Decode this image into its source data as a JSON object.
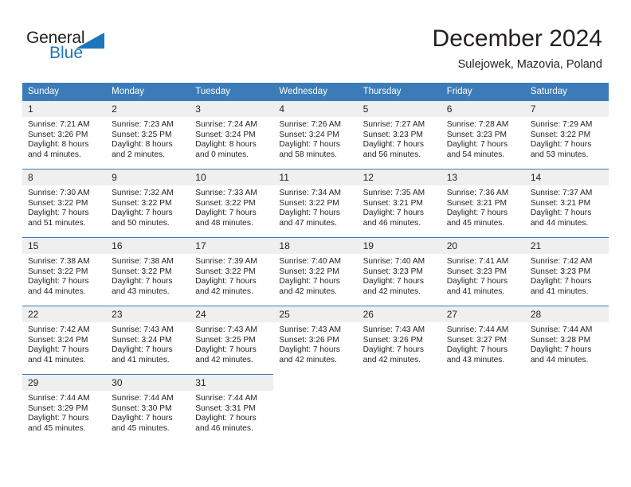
{
  "brand": {
    "name_part1": "General",
    "name_part2": "Blue",
    "triangle_color": "#1b76bc"
  },
  "header": {
    "title": "December 2024",
    "location": "Sulejowek, Mazovia, Poland"
  },
  "colors": {
    "header_row": "#3b7cb8",
    "daynum_background": "#efefef",
    "text": "#231f20"
  },
  "weekday_headers": [
    "Sunday",
    "Monday",
    "Tuesday",
    "Wednesday",
    "Thursday",
    "Friday",
    "Saturday"
  ],
  "weeks": [
    [
      {
        "day": "1",
        "sunrise": "Sunrise: 7:21 AM",
        "sunset": "Sunset: 3:26 PM",
        "daylight1": "Daylight: 8 hours",
        "daylight2": "and 4 minutes."
      },
      {
        "day": "2",
        "sunrise": "Sunrise: 7:23 AM",
        "sunset": "Sunset: 3:25 PM",
        "daylight1": "Daylight: 8 hours",
        "daylight2": "and 2 minutes."
      },
      {
        "day": "3",
        "sunrise": "Sunrise: 7:24 AM",
        "sunset": "Sunset: 3:24 PM",
        "daylight1": "Daylight: 8 hours",
        "daylight2": "and 0 minutes."
      },
      {
        "day": "4",
        "sunrise": "Sunrise: 7:26 AM",
        "sunset": "Sunset: 3:24 PM",
        "daylight1": "Daylight: 7 hours",
        "daylight2": "and 58 minutes."
      },
      {
        "day": "5",
        "sunrise": "Sunrise: 7:27 AM",
        "sunset": "Sunset: 3:23 PM",
        "daylight1": "Daylight: 7 hours",
        "daylight2": "and 56 minutes."
      },
      {
        "day": "6",
        "sunrise": "Sunrise: 7:28 AM",
        "sunset": "Sunset: 3:23 PM",
        "daylight1": "Daylight: 7 hours",
        "daylight2": "and 54 minutes."
      },
      {
        "day": "7",
        "sunrise": "Sunrise: 7:29 AM",
        "sunset": "Sunset: 3:22 PM",
        "daylight1": "Daylight: 7 hours",
        "daylight2": "and 53 minutes."
      }
    ],
    [
      {
        "day": "8",
        "sunrise": "Sunrise: 7:30 AM",
        "sunset": "Sunset: 3:22 PM",
        "daylight1": "Daylight: 7 hours",
        "daylight2": "and 51 minutes."
      },
      {
        "day": "9",
        "sunrise": "Sunrise: 7:32 AM",
        "sunset": "Sunset: 3:22 PM",
        "daylight1": "Daylight: 7 hours",
        "daylight2": "and 50 minutes."
      },
      {
        "day": "10",
        "sunrise": "Sunrise: 7:33 AM",
        "sunset": "Sunset: 3:22 PM",
        "daylight1": "Daylight: 7 hours",
        "daylight2": "and 48 minutes."
      },
      {
        "day": "11",
        "sunrise": "Sunrise: 7:34 AM",
        "sunset": "Sunset: 3:22 PM",
        "daylight1": "Daylight: 7 hours",
        "daylight2": "and 47 minutes."
      },
      {
        "day": "12",
        "sunrise": "Sunrise: 7:35 AM",
        "sunset": "Sunset: 3:21 PM",
        "daylight1": "Daylight: 7 hours",
        "daylight2": "and 46 minutes."
      },
      {
        "day": "13",
        "sunrise": "Sunrise: 7:36 AM",
        "sunset": "Sunset: 3:21 PM",
        "daylight1": "Daylight: 7 hours",
        "daylight2": "and 45 minutes."
      },
      {
        "day": "14",
        "sunrise": "Sunrise: 7:37 AM",
        "sunset": "Sunset: 3:21 PM",
        "daylight1": "Daylight: 7 hours",
        "daylight2": "and 44 minutes."
      }
    ],
    [
      {
        "day": "15",
        "sunrise": "Sunrise: 7:38 AM",
        "sunset": "Sunset: 3:22 PM",
        "daylight1": "Daylight: 7 hours",
        "daylight2": "and 44 minutes."
      },
      {
        "day": "16",
        "sunrise": "Sunrise: 7:38 AM",
        "sunset": "Sunset: 3:22 PM",
        "daylight1": "Daylight: 7 hours",
        "daylight2": "and 43 minutes."
      },
      {
        "day": "17",
        "sunrise": "Sunrise: 7:39 AM",
        "sunset": "Sunset: 3:22 PM",
        "daylight1": "Daylight: 7 hours",
        "daylight2": "and 42 minutes."
      },
      {
        "day": "18",
        "sunrise": "Sunrise: 7:40 AM",
        "sunset": "Sunset: 3:22 PM",
        "daylight1": "Daylight: 7 hours",
        "daylight2": "and 42 minutes."
      },
      {
        "day": "19",
        "sunrise": "Sunrise: 7:40 AM",
        "sunset": "Sunset: 3:23 PM",
        "daylight1": "Daylight: 7 hours",
        "daylight2": "and 42 minutes."
      },
      {
        "day": "20",
        "sunrise": "Sunrise: 7:41 AM",
        "sunset": "Sunset: 3:23 PM",
        "daylight1": "Daylight: 7 hours",
        "daylight2": "and 41 minutes."
      },
      {
        "day": "21",
        "sunrise": "Sunrise: 7:42 AM",
        "sunset": "Sunset: 3:23 PM",
        "daylight1": "Daylight: 7 hours",
        "daylight2": "and 41 minutes."
      }
    ],
    [
      {
        "day": "22",
        "sunrise": "Sunrise: 7:42 AM",
        "sunset": "Sunset: 3:24 PM",
        "daylight1": "Daylight: 7 hours",
        "daylight2": "and 41 minutes."
      },
      {
        "day": "23",
        "sunrise": "Sunrise: 7:43 AM",
        "sunset": "Sunset: 3:24 PM",
        "daylight1": "Daylight: 7 hours",
        "daylight2": "and 41 minutes."
      },
      {
        "day": "24",
        "sunrise": "Sunrise: 7:43 AM",
        "sunset": "Sunset: 3:25 PM",
        "daylight1": "Daylight: 7 hours",
        "daylight2": "and 42 minutes."
      },
      {
        "day": "25",
        "sunrise": "Sunrise: 7:43 AM",
        "sunset": "Sunset: 3:26 PM",
        "daylight1": "Daylight: 7 hours",
        "daylight2": "and 42 minutes."
      },
      {
        "day": "26",
        "sunrise": "Sunrise: 7:43 AM",
        "sunset": "Sunset: 3:26 PM",
        "daylight1": "Daylight: 7 hours",
        "daylight2": "and 42 minutes."
      },
      {
        "day": "27",
        "sunrise": "Sunrise: 7:44 AM",
        "sunset": "Sunset: 3:27 PM",
        "daylight1": "Daylight: 7 hours",
        "daylight2": "and 43 minutes."
      },
      {
        "day": "28",
        "sunrise": "Sunrise: 7:44 AM",
        "sunset": "Sunset: 3:28 PM",
        "daylight1": "Daylight: 7 hours",
        "daylight2": "and 44 minutes."
      }
    ],
    [
      {
        "day": "29",
        "sunrise": "Sunrise: 7:44 AM",
        "sunset": "Sunset: 3:29 PM",
        "daylight1": "Daylight: 7 hours",
        "daylight2": "and 45 minutes."
      },
      {
        "day": "30",
        "sunrise": "Sunrise: 7:44 AM",
        "sunset": "Sunset: 3:30 PM",
        "daylight1": "Daylight: 7 hours",
        "daylight2": "and 45 minutes."
      },
      {
        "day": "31",
        "sunrise": "Sunrise: 7:44 AM",
        "sunset": "Sunset: 3:31 PM",
        "daylight1": "Daylight: 7 hours",
        "daylight2": "and 46 minutes."
      },
      {
        "day": "",
        "sunrise": "",
        "sunset": "",
        "daylight1": "",
        "daylight2": ""
      },
      {
        "day": "",
        "sunrise": "",
        "sunset": "",
        "daylight1": "",
        "daylight2": ""
      },
      {
        "day": "",
        "sunrise": "",
        "sunset": "",
        "daylight1": "",
        "daylight2": ""
      },
      {
        "day": "",
        "sunrise": "",
        "sunset": "",
        "daylight1": "",
        "daylight2": ""
      }
    ]
  ]
}
